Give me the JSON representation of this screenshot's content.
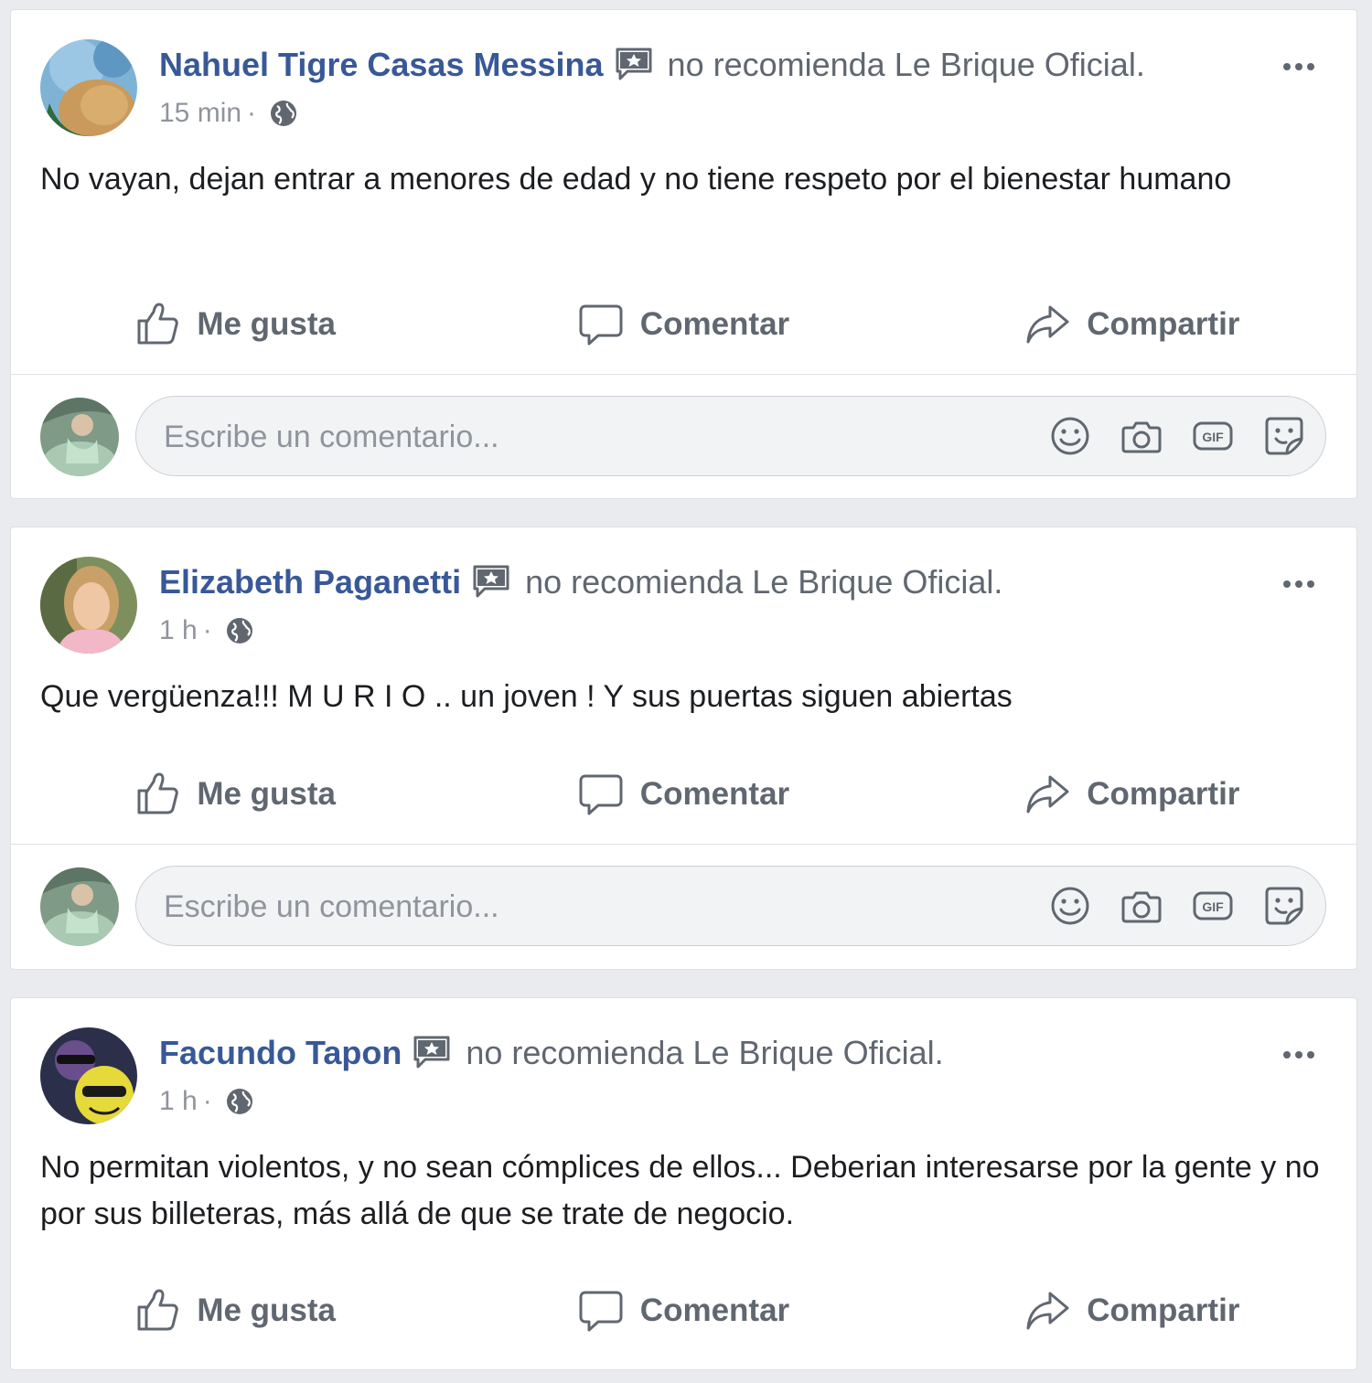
{
  "posts": [
    {
      "author": "Nahuel Tigre Casas Messina",
      "recommendation": "no recomienda Le Brique Oficial.",
      "time": "15 min",
      "separator": "·",
      "text": "No vayan, dejan entrar a menores de edad y no tiene respeto por el bienestar humano"
    },
    {
      "author": "Elizabeth Paganetti",
      "recommendation": "no recomienda Le Brique Oficial.",
      "time": "1 h",
      "separator": "·",
      "text": "Que vergüenza!!! M U R I O .. un joven ! Y sus puertas siguen abiertas"
    },
    {
      "author": "Facundo Tapon",
      "recommendation": "no recomienda Le Brique Oficial.",
      "time": "1 h",
      "separator": "·",
      "text": "No permitan violentos, y no sean cómplices de ellos... Deberian interesarse por la gente y no por sus billeteras, más allá de que se trate de negocio."
    }
  ],
  "actions": {
    "like": "Me gusta",
    "comment": "Comentar",
    "share": "Compartir"
  },
  "comment_box": {
    "placeholder": "Escribe un comentario..."
  },
  "icons": {
    "recommend": "recommend-star-icon",
    "privacy": "globe-icon",
    "more": "more-options-icon",
    "like": "thumbs-up-icon",
    "comment": "speech-bubble-icon",
    "share": "share-arrow-icon",
    "emoji": "emoji-icon",
    "camera": "camera-icon",
    "gif": "gif-icon",
    "sticker": "sticker-icon"
  },
  "colors": {
    "author": "#385898",
    "secondary_text": "#606770",
    "meta_text": "#90949c",
    "body_text": "#1c1e21",
    "background": "#e9ebee"
  }
}
